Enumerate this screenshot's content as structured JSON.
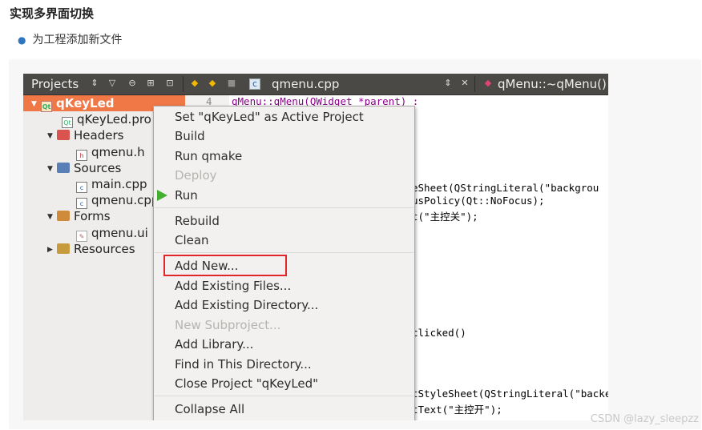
{
  "article": {
    "heading": "实现多界面切换",
    "bullet": "为工程添加新文件",
    "watermark": "CSDN @lazy_sleepzz"
  },
  "toolbar": {
    "projects_label": "Projects",
    "file_name": "qmenu.cpp",
    "function_name": "qMenu::~qMenu()"
  },
  "tree": {
    "project": "qKeyLed",
    "items": [
      {
        "label": "qKeyLed.pro"
      },
      {
        "label": "Headers"
      },
      {
        "label": "qmenu.h"
      },
      {
        "label": "Sources"
      },
      {
        "label": "main.cpp"
      },
      {
        "label": "qmenu.cpp"
      },
      {
        "label": "Forms"
      },
      {
        "label": "qmenu.ui"
      },
      {
        "label": "Resources"
      }
    ]
  },
  "editor": {
    "line_number": "4",
    "line1": "qMenu::qMenu(QWidget *parent) :",
    "line2": "eSheet(QStringLiteral(\"backgrou",
    "line3": "usPolicy(Qt::NoFocus);",
    "line4": "t(\"主控关\");",
    "line5": "clicked()",
    "line6": "tStyleSheet(QStringLiteral(\"backe",
    "line7": "tText(\"主控开\");"
  },
  "menu": {
    "items": [
      {
        "label": "Set \"qKeyLed\" as Active Project",
        "enabled": true
      },
      {
        "label": "Build",
        "enabled": true
      },
      {
        "label": "Run qmake",
        "enabled": true
      },
      {
        "label": "Deploy",
        "enabled": false
      },
      {
        "label": "Run",
        "enabled": true
      },
      {
        "label": "Rebuild",
        "enabled": true
      },
      {
        "label": "Clean",
        "enabled": true
      },
      {
        "label": "Add New...",
        "enabled": true,
        "highlighted": true
      },
      {
        "label": "Add Existing Files...",
        "enabled": true
      },
      {
        "label": "Add Existing Directory...",
        "enabled": true
      },
      {
        "label": "New Subproject...",
        "enabled": false
      },
      {
        "label": "Add Library...",
        "enabled": true
      },
      {
        "label": "Find in This Directory...",
        "enabled": true
      },
      {
        "label": "Close Project \"qKeyLed\"",
        "enabled": true
      },
      {
        "label": "Collapse All",
        "enabled": true
      }
    ]
  },
  "colors": {
    "selection": "#f07746",
    "highlight_box": "#e0262a",
    "run_icon": "#42b02e"
  }
}
